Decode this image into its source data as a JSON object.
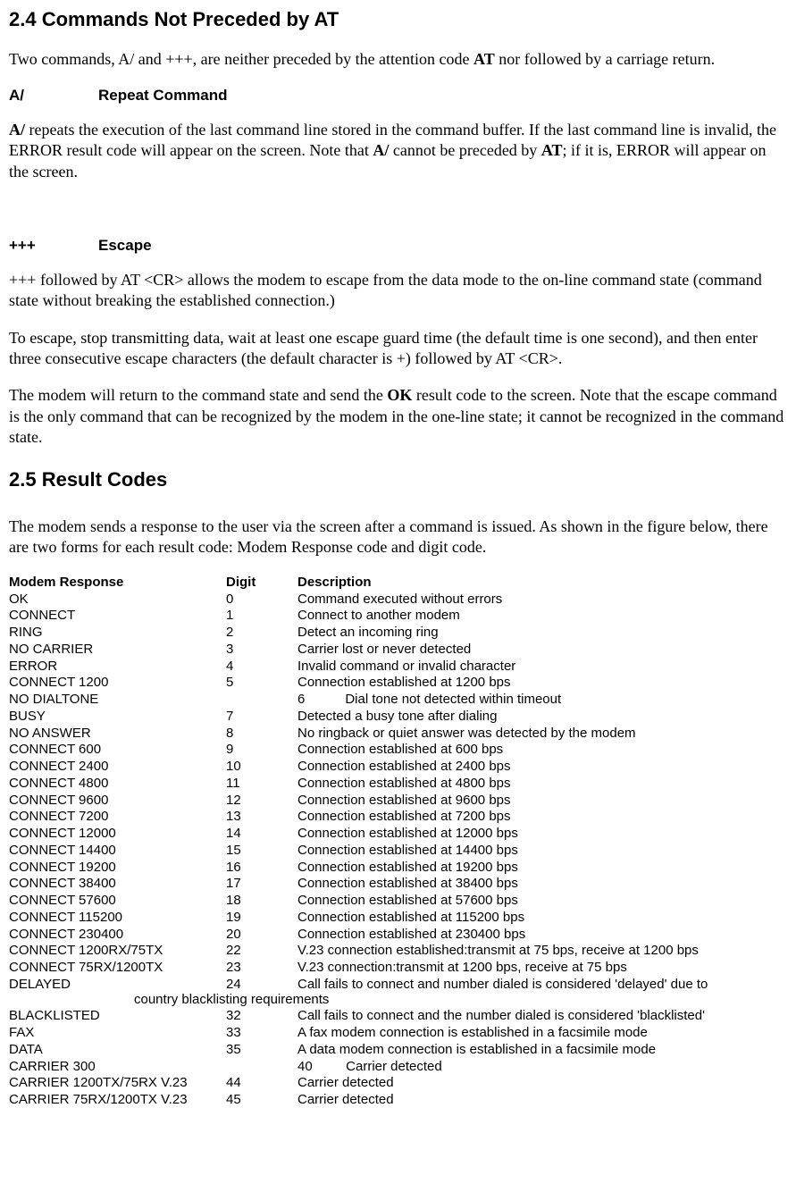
{
  "section24": {
    "title": "2.4 Commands Not Preceded by AT",
    "intro_pre": "Two commands, A/ and +++, are neither preceded by the attention code ",
    "intro_bold": "AT",
    "intro_post": " nor followed by a carriage return.",
    "aslash": {
      "cmd": "A/",
      "label": "Repeat Command",
      "p1_a": "A/",
      "p1_b": " repeats the execution of the last command line stored in the command buffer. If the last command line is invalid, the ERROR result code will appear on the screen. Note that ",
      "p1_c": "A/",
      "p1_d": " cannot be preceded by ",
      "p1_e": "AT",
      "p1_f": "; if it is, ERROR will appear on the screen."
    },
    "escape": {
      "cmd": "+++",
      "label": "Escape",
      "p1": "+++ followed by AT <CR> allows the modem to escape from the data mode to the on-line command state (command state without breaking the established connection.)",
      "p2": "To escape, stop transmitting data, wait at least one escape guard time (the default time is one second), and then enter three consecutive escape characters (the default character is +) followed by AT <CR>.",
      "p3_a": "The modem will return to the command state and send the ",
      "p3_b": "OK",
      "p3_c": " result code to the screen. Note that the escape command is the only command that can be recognized by the modem in the one-line state; it cannot be recognized in the command state."
    }
  },
  "section25": {
    "title": "2.5 Result Codes",
    "intro": "The modem sends a response to the user via the screen after a command is issued. As shown in the figure below, there are two forms for each result code: Modem Response code and digit code.",
    "headers": {
      "resp": "Modem Response",
      "digit": "Digit",
      "desc": "Description"
    },
    "rows": [
      {
        "resp": "OK",
        "digit": "0",
        "desc": "Command executed without errors"
      },
      {
        "resp": "CONNECT",
        "digit": "1",
        "desc": "Connect to another modem"
      },
      {
        "resp": "RING",
        "digit": "2",
        "desc": "Detect an incoming ring"
      },
      {
        "resp": "NO CARRIER",
        "digit": "3",
        "desc": "Carrier lost or never detected"
      },
      {
        "resp": "ERROR",
        "digit": "4",
        "desc": "Invalid command or invalid character"
      },
      {
        "resp": "CONNECT 1200",
        "digit": "5",
        "desc": "Connection established at 1200 bps"
      },
      {
        "resp": "NO DIALTONE",
        "digit": "",
        "desc": "6   Dial tone not detected within timeout"
      },
      {
        "resp": "BUSY",
        "digit": "7",
        "desc": "Detected a busy tone after dialing"
      },
      {
        "resp": "NO ANSWER",
        "digit": "8",
        "desc": "No ringback or quiet answer was detected by  the modem"
      },
      {
        "resp": "CONNECT 600",
        "digit": "9",
        "desc": "Connection established at 600 bps"
      },
      {
        "resp": "CONNECT 2400",
        "digit": "10",
        "desc": "Connection established at 2400 bps"
      },
      {
        "resp": "CONNECT 4800",
        "digit": "11",
        "desc": "Connection established at 4800 bps"
      },
      {
        "resp": "CONNECT 9600",
        "digit": "12",
        "desc": "Connection established at 9600 bps"
      },
      {
        "resp": "CONNECT 7200",
        "digit": "13",
        "desc": "Connection established at 7200 bps"
      },
      {
        "resp": "CONNECT 12000",
        "digit": "14",
        "desc": "Connection established at 12000 bps"
      },
      {
        "resp": "CONNECT 14400",
        "digit": "15",
        "desc": "Connection established at 14400 bps"
      },
      {
        "resp": "CONNECT 19200",
        "digit": "16",
        "desc": "Connection established at 19200 bps"
      },
      {
        "resp": "CONNECT 38400",
        "digit": "17",
        "desc": "Connection established at 38400 bps"
      },
      {
        "resp": "CONNECT 57600",
        "digit": "18",
        "desc": "Connection established at 57600 bps"
      },
      {
        "resp": "CONNECT 115200",
        "digit": "19",
        "desc": "Connection established at 115200 bps"
      },
      {
        "resp": "CONNECT 230400",
        "digit": "20",
        "desc": "Connection established at 230400 bps"
      },
      {
        "resp": "CONNECT 1200RX/75TX",
        "digit": "22",
        "desc": "V.23 connection established:transmit at 75 bps, receive at 1200 bps"
      },
      {
        "resp": "CONNECT 75RX/1200TX",
        "digit": "23",
        "desc": "V.23 connection:transmit at 1200 bps, receive at 75 bps"
      },
      {
        "resp": "DELAYED",
        "digit": "24",
        "desc": "Call fails to connect and number dialed is considered 'delayed' due to"
      }
    ],
    "delayed_wrap": "country blacklisting requirements",
    "rows2": [
      {
        "resp": "BLACKLISTED",
        "digit": "32",
        "desc": "Call fails to connect and the number dialed is considered 'blacklisted'"
      },
      {
        "resp": "FAX",
        "digit": "33",
        "desc": "A fax modem connection is established in a facsimile mode"
      },
      {
        "resp": "DATA",
        "digit": "35",
        "desc": "A data modem connection is established in a facsimile mode"
      },
      {
        "resp": "CARRIER 300",
        "digit": "",
        "desc": "40   Carrier detected"
      },
      {
        "resp": "CARRIER 1200TX/75RX V.23",
        "digit": "44",
        "desc": "Carrier detected"
      },
      {
        "resp": "CARRIER 75RX/1200TX V.23",
        "digit": "45",
        "desc": "Carrier detected"
      }
    ]
  }
}
